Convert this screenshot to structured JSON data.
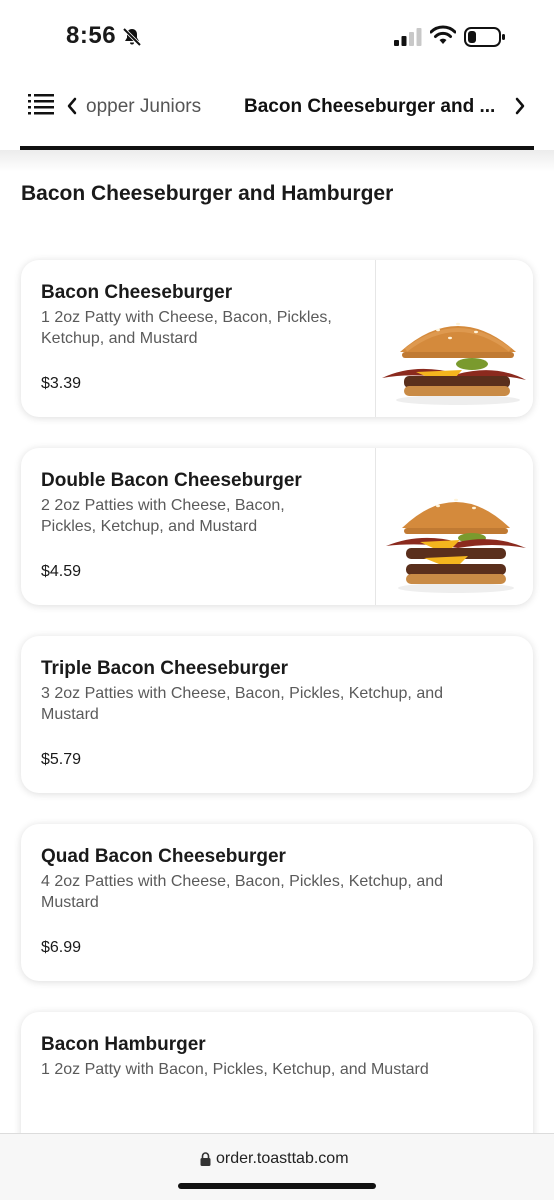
{
  "status": {
    "time": "8:56"
  },
  "nav": {
    "prev_category": "opper Juniors",
    "current_category": "Bacon Cheeseburger and ..."
  },
  "section": {
    "title": "Bacon Cheeseburger and Hamburger"
  },
  "items": [
    {
      "name": "Bacon Cheeseburger",
      "description": "1 2oz Patty with Cheese, Bacon, Pickles, Ketchup, and Mustard",
      "price": "$3.39",
      "image": "single-bacon-cheeseburger"
    },
    {
      "name": "Double Bacon Cheeseburger",
      "description": "2 2oz Patties with Cheese, Bacon, Pickles, Ketchup, and Mustard",
      "price": "$4.59",
      "image": "double-bacon-cheeseburger"
    },
    {
      "name": "Triple Bacon Cheeseburger",
      "description": "3 2oz Patties with Cheese, Bacon, Pickles, Ketchup, and Mustard",
      "price": "$5.79"
    },
    {
      "name": "Quad Bacon Cheeseburger",
      "description": "4 2oz Patties with Cheese, Bacon, Pickles, Ketchup, and Mustard",
      "price": "$6.99"
    },
    {
      "name": "Bacon Hamburger",
      "description": "1 2oz Patty with Bacon, Pickles, Ketchup, and Mustard",
      "price": ""
    }
  ],
  "browser": {
    "url": "order.toasttab.com"
  },
  "icons": {
    "status": [
      "bell-slash-icon",
      "cellular-signal-icon",
      "wifi-icon",
      "battery-icon"
    ],
    "nav": [
      "menu-list-icon",
      "chevron-left-icon",
      "chevron-right-icon"
    ],
    "browser": [
      "lock-icon"
    ]
  },
  "colors": {
    "text": "#1a1a1a",
    "muted": "#5a5a5a",
    "underline": "#111111"
  }
}
